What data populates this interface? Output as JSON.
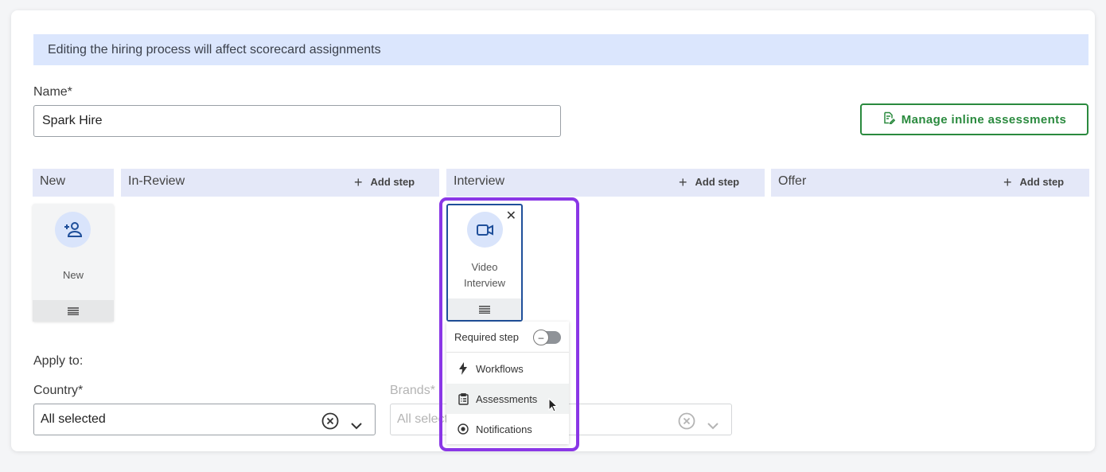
{
  "banner": {
    "text": "Editing the hiring process will affect scorecard assignments"
  },
  "name_field": {
    "label": "Name*",
    "value": "Spark Hire"
  },
  "manage_button": {
    "label": "Manage inline assessments"
  },
  "columns": [
    {
      "title": "New"
    },
    {
      "title": "In-Review",
      "add_label": "Add step"
    },
    {
      "title": "Interview",
      "add_label": "Add step"
    },
    {
      "title": "Offer",
      "add_label": "Add step"
    }
  ],
  "steps": {
    "new": {
      "name": "New",
      "icon": "add-user-icon"
    },
    "video": {
      "name_line1": "Video",
      "name_line2": "Interview",
      "icon": "video-camera-icon"
    }
  },
  "step_menu": {
    "required_label": "Required step",
    "required_on": false,
    "items": [
      {
        "label": "Workflows",
        "icon": "lightning-icon"
      },
      {
        "label": "Assessments",
        "icon": "clipboard-icon"
      },
      {
        "label": "Notifications",
        "icon": "notification-dot-icon"
      }
    ]
  },
  "apply_to": {
    "label": "Apply to:"
  },
  "country": {
    "label": "Country*",
    "value": "All selected"
  },
  "brands": {
    "label": "Brands*",
    "value": "All selected"
  },
  "colors": {
    "accent_green": "#2a8a3e",
    "highlight_purple": "#8a37e6",
    "step_blue": "#1f4f9a",
    "banner_bg": "#dbe6fd"
  }
}
